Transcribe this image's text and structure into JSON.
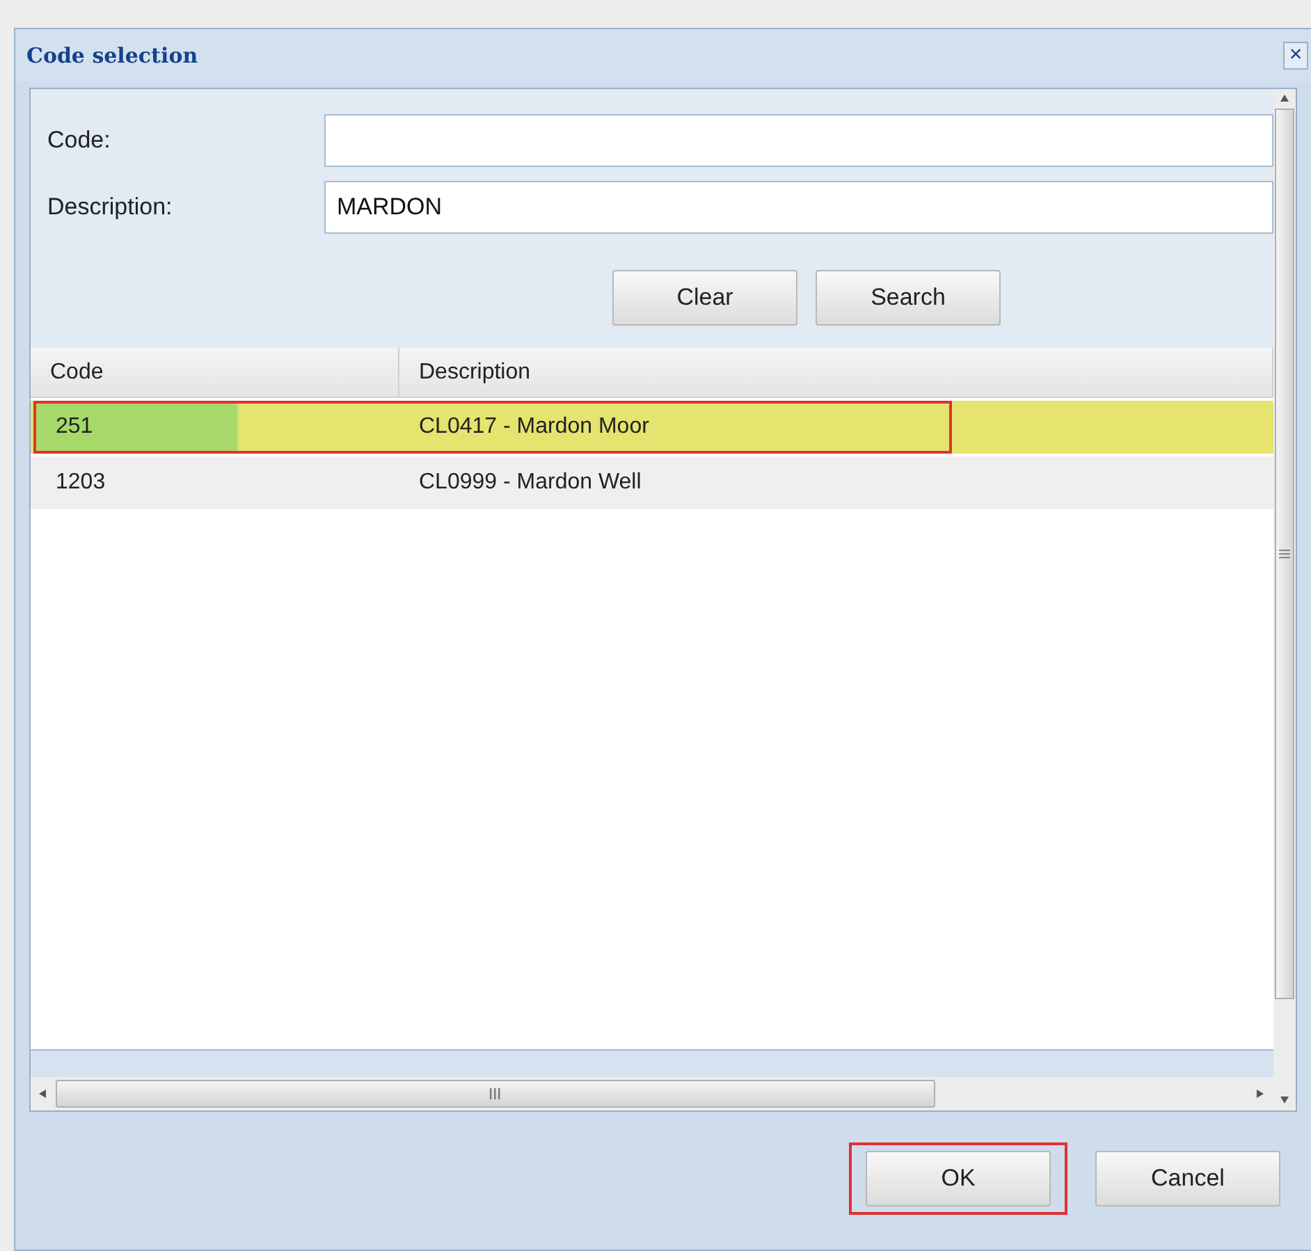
{
  "window": {
    "title": "Code selection",
    "close": "×"
  },
  "form": {
    "fields": [
      {
        "label": "Code:"
      },
      {
        "label": "Description:",
        "value": "MARDON"
      }
    ],
    "buttons": [
      "Clear",
      "Search"
    ]
  },
  "table": {
    "columns": [
      "Code",
      "Description"
    ],
    "rows": [
      {
        "code": "251",
        "description": "CL0417 - Mardon Moor",
        "selected": true
      },
      {
        "code": "1203",
        "description": "CL0999 - Mardon Well",
        "selected": false
      }
    ]
  },
  "footer_buttons": [
    {
      "label": "OK",
      "focused": true
    },
    {
      "label": "Cancel",
      "focused": false
    }
  ]
}
